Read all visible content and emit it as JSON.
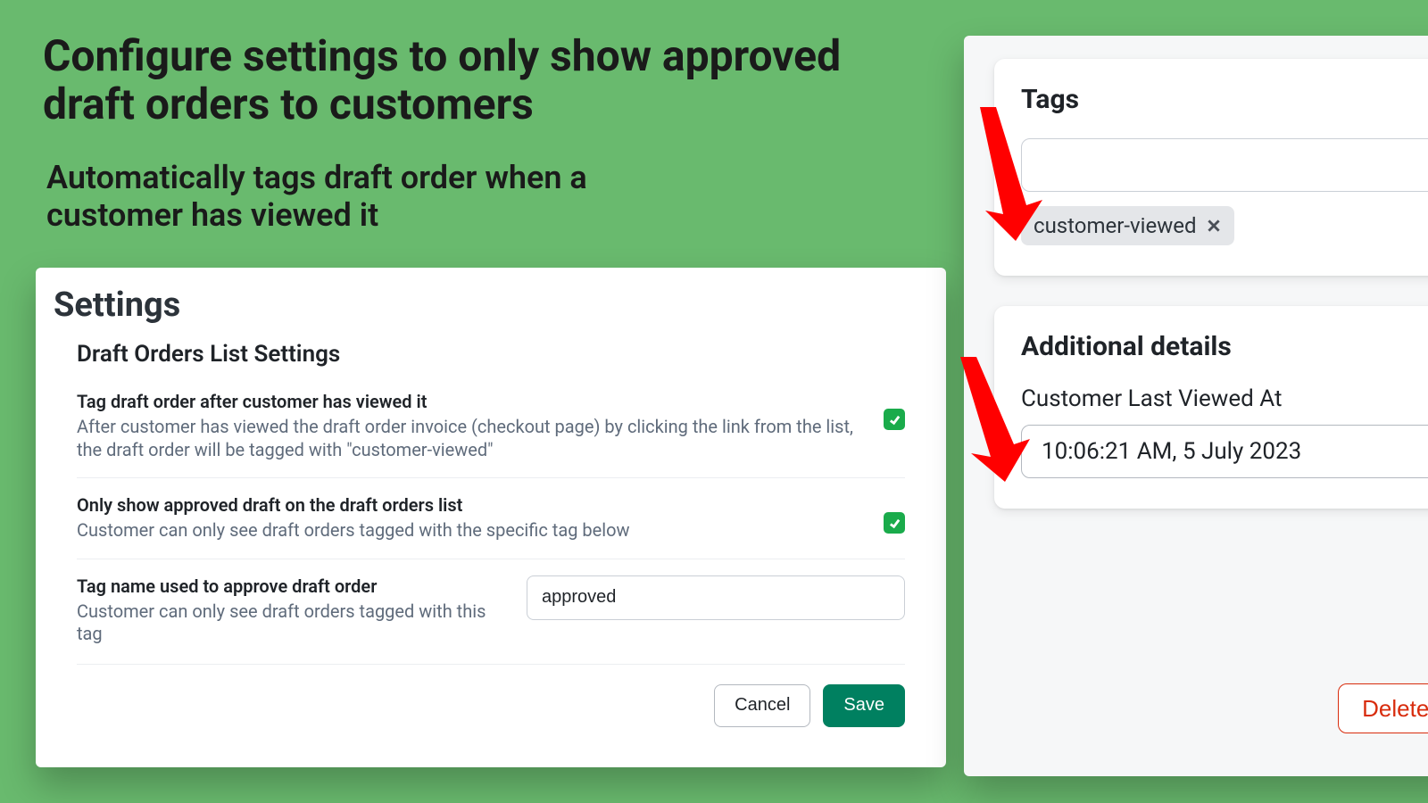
{
  "headline": "Configure settings to only show approved draft orders to customers",
  "subheadline": "Automatically tags draft order when a customer has viewed it",
  "settings": {
    "title": "Settings",
    "section": "Draft Orders List Settings",
    "row1": {
      "label": "Tag draft order after customer has viewed it",
      "desc": "After customer has viewed the draft order invoice (checkout page) by clicking the link from the list, the draft order will be tagged with \"customer-viewed\"",
      "checked": true
    },
    "row2": {
      "label": "Only show approved draft on the draft orders list",
      "desc": "Customer can only see draft orders tagged with the specific tag below",
      "checked": true
    },
    "tag_name": {
      "label": "Tag name used to approve draft order",
      "desc": "Customer can only see draft orders tagged with this tag",
      "value": "approved"
    },
    "cancel": "Cancel",
    "save": "Save"
  },
  "right": {
    "tags_title": "Tags",
    "tag_chip": "customer-viewed",
    "details_title": "Additional details",
    "last_viewed_label": "Customer Last Viewed At",
    "last_viewed_value": "10:06:21 AM, 5 July 2023",
    "delete": "Delete d"
  }
}
